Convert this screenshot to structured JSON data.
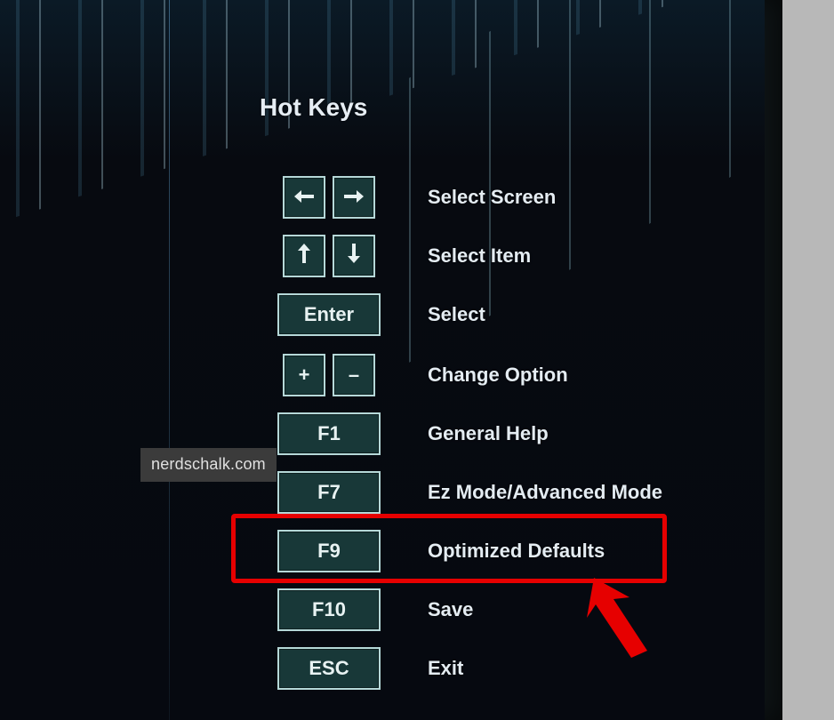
{
  "title": "Hot Keys",
  "watermark": "nerdschalk.com",
  "rows": {
    "select_screen": {
      "label": "Select Screen"
    },
    "select_item": {
      "label": "Select Item"
    },
    "select": {
      "key": "Enter",
      "label": "Select"
    },
    "change_option": {
      "plus": "+",
      "minus": "–",
      "label": "Change Option"
    },
    "general_help": {
      "key": "F1",
      "label": "General Help"
    },
    "ez_mode": {
      "key": "F7",
      "label": "Ez Mode/Advanced Mode"
    },
    "opt_defaults": {
      "key": "F9",
      "label": "Optimized Defaults"
    },
    "save": {
      "key": "F10",
      "label": "Save"
    },
    "exit": {
      "key": "ESC",
      "label": "Exit"
    }
  },
  "highlighted_row": "opt_defaults",
  "colors": {
    "key_bg": "#183838",
    "key_border": "#b5d8d8",
    "highlight": "#e60000"
  }
}
